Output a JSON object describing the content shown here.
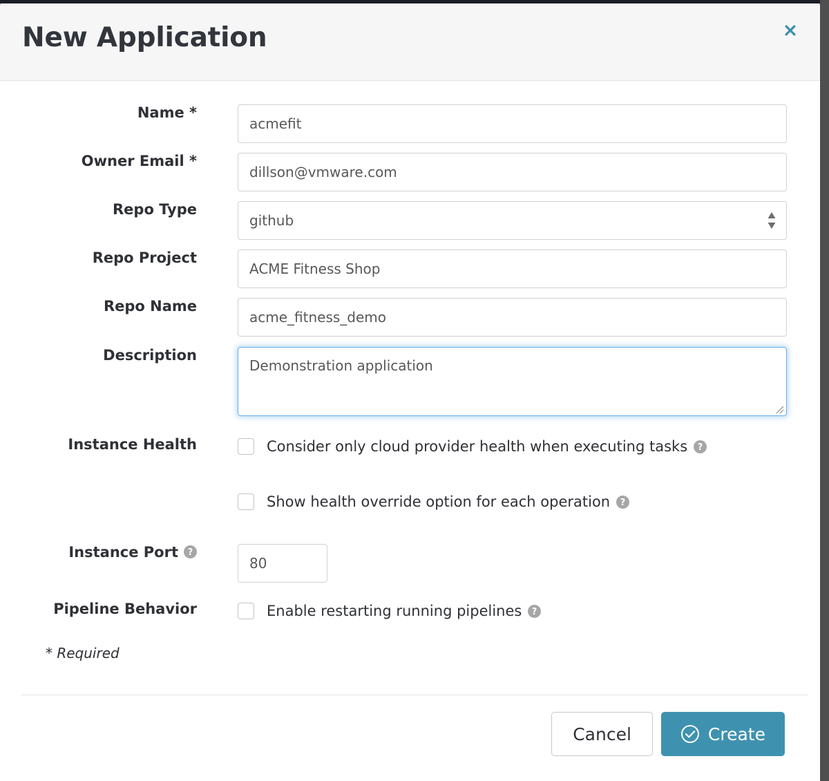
{
  "modal": {
    "title": "New Application",
    "close_icon": "close-x-icon"
  },
  "form": {
    "name": {
      "label": "Name *",
      "value": "acmefit",
      "placeholder": ""
    },
    "owner_email": {
      "label": "Owner Email *",
      "value": "dillson@vmware.com",
      "placeholder": ""
    },
    "repo_type": {
      "label": "Repo Type",
      "value": "github",
      "spinner_icon": "updown-spinner-icon",
      "options": [
        "github"
      ]
    },
    "repo_project": {
      "label": "Repo Project",
      "value": "ACME Fitness Shop",
      "placeholder": ""
    },
    "repo_name": {
      "label": "Repo Name",
      "value": "acme_fitness_demo",
      "placeholder": ""
    },
    "description": {
      "label": "Description",
      "value": "Demonstration application",
      "placeholder": "",
      "resize_icon": "resize-grip-icon"
    },
    "instance_health": {
      "label": "Instance Health",
      "options": [
        {
          "text": "Consider only cloud provider health when executing tasks",
          "checked": false,
          "help_icon": "help-question-icon"
        },
        {
          "text": "Show health override option for each operation",
          "checked": false,
          "help_icon": "help-question-icon"
        }
      ]
    },
    "instance_port": {
      "label": "Instance Port",
      "help_icon": "help-question-icon",
      "value": "80",
      "placeholder": ""
    },
    "pipeline_behavior": {
      "label": "Pipeline Behavior",
      "option": {
        "text": "Enable restarting running pipelines",
        "checked": false,
        "help_icon": "help-question-icon"
      }
    },
    "required_note": "* Required"
  },
  "footer": {
    "cancel_label": "Cancel",
    "create_label": "Create",
    "create_icon": "check-circle-icon"
  },
  "colors": {
    "accent_teal": "#3e92b0",
    "close_teal": "#3d8fad",
    "focus_blue": "#66afe9",
    "header_bg": "#f6f6f7",
    "text_dark": "#2f3136",
    "input_text": "#585858",
    "border_gray": "#d2d2d2",
    "topbar_dark": "#1b1e26"
  }
}
